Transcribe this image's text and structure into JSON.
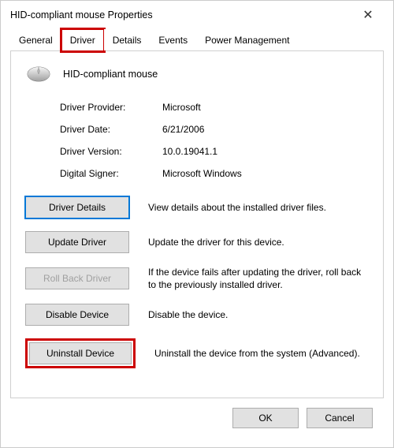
{
  "title": "HID-compliant mouse Properties",
  "tabs": {
    "general": "General",
    "driver": "Driver",
    "details": "Details",
    "events": "Events",
    "power": "Power Management"
  },
  "device_name": "HID-compliant mouse",
  "info": {
    "provider_label": "Driver Provider:",
    "provider_value": "Microsoft",
    "date_label": "Driver Date:",
    "date_value": "6/21/2006",
    "version_label": "Driver Version:",
    "version_value": "10.0.19041.1",
    "signer_label": "Digital Signer:",
    "signer_value": "Microsoft Windows"
  },
  "actions": {
    "details_btn": "Driver Details",
    "details_desc": "View details about the installed driver files.",
    "update_btn": "Update Driver",
    "update_desc": "Update the driver for this device.",
    "rollback_btn": "Roll Back Driver",
    "rollback_desc": "If the device fails after updating the driver, roll back to the previously installed driver.",
    "disable_btn": "Disable Device",
    "disable_desc": "Disable the device.",
    "uninstall_btn": "Uninstall Device",
    "uninstall_desc": "Uninstall the device from the system (Advanced)."
  },
  "footer": {
    "ok": "OK",
    "cancel": "Cancel"
  }
}
